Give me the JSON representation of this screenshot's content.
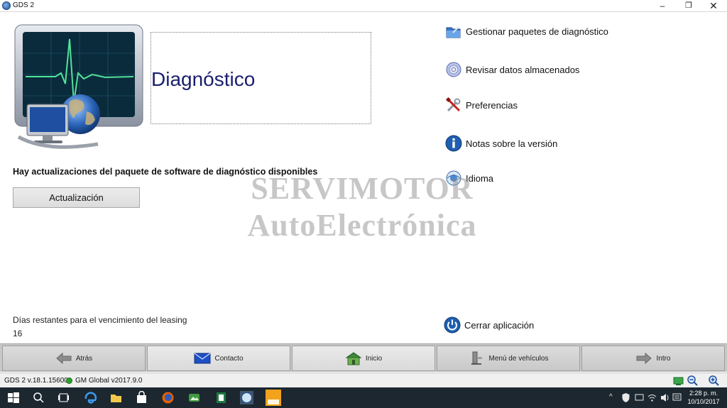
{
  "window": {
    "title": "GDS 2",
    "minimize_glyph": "–",
    "maximize_glyph": "❐",
    "close_glyph": "✕"
  },
  "main": {
    "title": "Diagnóstico",
    "update_message": "Hay actualizaciones del paquete de software de diagnóstico disponibles",
    "update_button": "Actualización",
    "lease_label": "Días restantes para el vencimiento del leasing",
    "lease_days": "16",
    "watermark_line1": "SERVIMOTOR",
    "watermark_line2": "AutoElectrónica"
  },
  "menu": {
    "items": [
      {
        "label": "Gestionar paquetes de diagnóstico",
        "icon": "package-folder-icon"
      },
      {
        "label": "Revisar datos almacenados",
        "icon": "disc-icon"
      },
      {
        "label": "Preferencias",
        "icon": "tools-icon"
      },
      {
        "label": "Notas sobre la versión",
        "icon": "info-icon"
      },
      {
        "label": "Idioma",
        "icon": "language-icon"
      }
    ],
    "close_label": "Cerrar aplicación"
  },
  "nav": {
    "items": [
      {
        "label": "Atrás",
        "icon": "back-arrow-icon"
      },
      {
        "label": "Contacto",
        "icon": "envelope-icon"
      },
      {
        "label": "Inicio",
        "icon": "home-icon"
      },
      {
        "label": "Menú de vehículos",
        "icon": "vehicle-lift-icon"
      },
      {
        "label": "Intro",
        "icon": "forward-arrow-icon"
      }
    ]
  },
  "status": {
    "version": "GDS 2 v.18.1.15600",
    "global": "GM Global v2017.9.0",
    "connection_color": "#2ca02c"
  },
  "taskbar": {
    "time": "2:28 p. m.",
    "date": "10/10/2017",
    "tray_up_glyph": "^",
    "apps": [
      "windows-start-icon",
      "search-icon",
      "task-view-icon",
      "edge-icon",
      "file-explorer-icon",
      "store-icon",
      "firefox-icon",
      "photos-icon",
      "excel-icon",
      "gds-icon",
      "tech2win-icon"
    ]
  },
  "colors": {
    "title": "#1a1f6e",
    "taskbar": "#1c2730",
    "navbar": "#c8c8c8"
  }
}
